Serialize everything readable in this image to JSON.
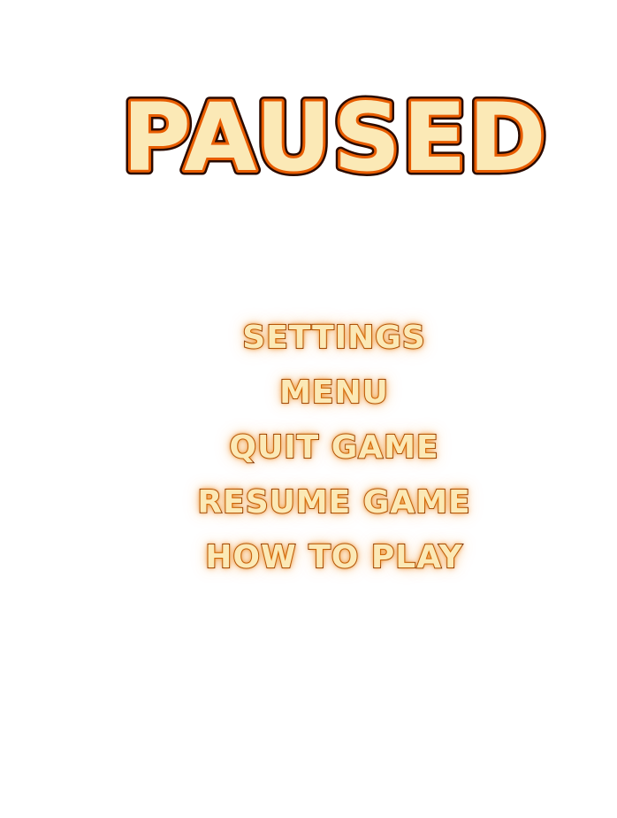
{
  "screen": {
    "title": "PAUSED"
  },
  "menu": {
    "items": [
      {
        "label": "SETTINGS"
      },
      {
        "label": "MENU"
      },
      {
        "label": "QUIT GAME"
      },
      {
        "label": "RESUME GAME"
      },
      {
        "label": "HOW TO PLAY"
      }
    ]
  },
  "colors": {
    "text_fill": "#fbe9b6",
    "outline_dark": "#2a0a00",
    "outline_orange": "#e85c00",
    "glow": "#f0a040"
  }
}
